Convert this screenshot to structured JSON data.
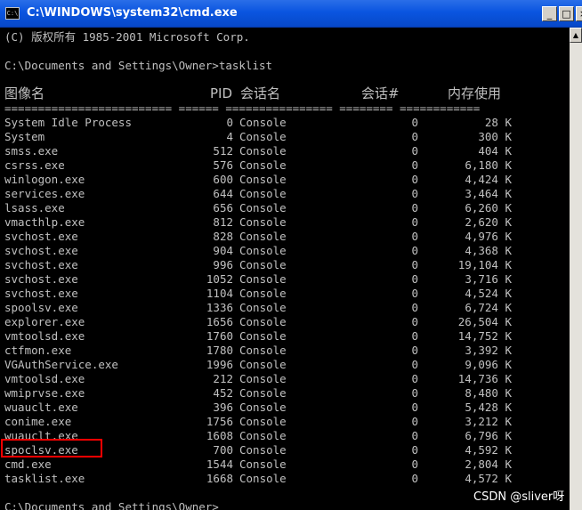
{
  "window": {
    "title": "C:\\WINDOWS\\system32\\cmd.exe",
    "icon_label": "C:\\",
    "minimize": "_",
    "maximize": "□",
    "close": "×"
  },
  "console": {
    "copyright": "(C) 版权所有 1985-2001 Microsoft Corp.",
    "prompt_command": "C:\\Documents and Settings\\Owner>tasklist",
    "headers": [
      "图像名",
      "PID",
      "会话名",
      "会话#",
      "内存使用"
    ],
    "separator": "========================= ====== ================ ======== ============",
    "rows": [
      {
        "name": "System Idle Process",
        "pid": "0",
        "session": "Console",
        "num": "0",
        "mem": "28 K"
      },
      {
        "name": "System",
        "pid": "4",
        "session": "Console",
        "num": "0",
        "mem": "300 K"
      },
      {
        "name": "smss.exe",
        "pid": "512",
        "session": "Console",
        "num": "0",
        "mem": "404 K"
      },
      {
        "name": "csrss.exe",
        "pid": "576",
        "session": "Console",
        "num": "0",
        "mem": "6,180 K"
      },
      {
        "name": "winlogon.exe",
        "pid": "600",
        "session": "Console",
        "num": "0",
        "mem": "4,424 K"
      },
      {
        "name": "services.exe",
        "pid": "644",
        "session": "Console",
        "num": "0",
        "mem": "3,464 K"
      },
      {
        "name": "lsass.exe",
        "pid": "656",
        "session": "Console",
        "num": "0",
        "mem": "6,260 K"
      },
      {
        "name": "vmacthlp.exe",
        "pid": "812",
        "session": "Console",
        "num": "0",
        "mem": "2,620 K"
      },
      {
        "name": "svchost.exe",
        "pid": "828",
        "session": "Console",
        "num": "0",
        "mem": "4,976 K"
      },
      {
        "name": "svchost.exe",
        "pid": "904",
        "session": "Console",
        "num": "0",
        "mem": "4,368 K"
      },
      {
        "name": "svchost.exe",
        "pid": "996",
        "session": "Console",
        "num": "0",
        "mem": "19,104 K"
      },
      {
        "name": "svchost.exe",
        "pid": "1052",
        "session": "Console",
        "num": "0",
        "mem": "3,716 K"
      },
      {
        "name": "svchost.exe",
        "pid": "1104",
        "session": "Console",
        "num": "0",
        "mem": "4,524 K"
      },
      {
        "name": "spoolsv.exe",
        "pid": "1336",
        "session": "Console",
        "num": "0",
        "mem": "6,724 K"
      },
      {
        "name": "explorer.exe",
        "pid": "1656",
        "session": "Console",
        "num": "0",
        "mem": "26,504 K"
      },
      {
        "name": "vmtoolsd.exe",
        "pid": "1760",
        "session": "Console",
        "num": "0",
        "mem": "14,752 K"
      },
      {
        "name": "ctfmon.exe",
        "pid": "1780",
        "session": "Console",
        "num": "0",
        "mem": "3,392 K"
      },
      {
        "name": "VGAuthService.exe",
        "pid": "1996",
        "session": "Console",
        "num": "0",
        "mem": "9,096 K"
      },
      {
        "name": "vmtoolsd.exe",
        "pid": "212",
        "session": "Console",
        "num": "0",
        "mem": "14,736 K"
      },
      {
        "name": "wmiprvse.exe",
        "pid": "452",
        "session": "Console",
        "num": "0",
        "mem": "8,480 K"
      },
      {
        "name": "wuauclt.exe",
        "pid": "396",
        "session": "Console",
        "num": "0",
        "mem": "5,428 K"
      },
      {
        "name": "conime.exe",
        "pid": "1756",
        "session": "Console",
        "num": "0",
        "mem": "3,212 K"
      },
      {
        "name": "wuauclt.exe",
        "pid": "1608",
        "session": "Console",
        "num": "0",
        "mem": "6,796 K"
      },
      {
        "name": "spoclsv.exe",
        "pid": "700",
        "session": "Console",
        "num": "0",
        "mem": "4,592 K"
      },
      {
        "name": "cmd.exe",
        "pid": "1544",
        "session": "Console",
        "num": "0",
        "mem": "2,804 K"
      },
      {
        "name": "tasklist.exe",
        "pid": "1668",
        "session": "Console",
        "num": "0",
        "mem": "4,572 K"
      }
    ],
    "final_prompt": "C:\\Documents and Settings\\Owner>"
  },
  "scrollbar": {
    "up_arrow": "▲"
  },
  "watermark": "CSDN @sliver呀",
  "colors": {
    "console_bg": "#000000",
    "console_text": "#c0c0c0",
    "titlebar": "#0a55e0",
    "highlight": "#ff0000"
  }
}
